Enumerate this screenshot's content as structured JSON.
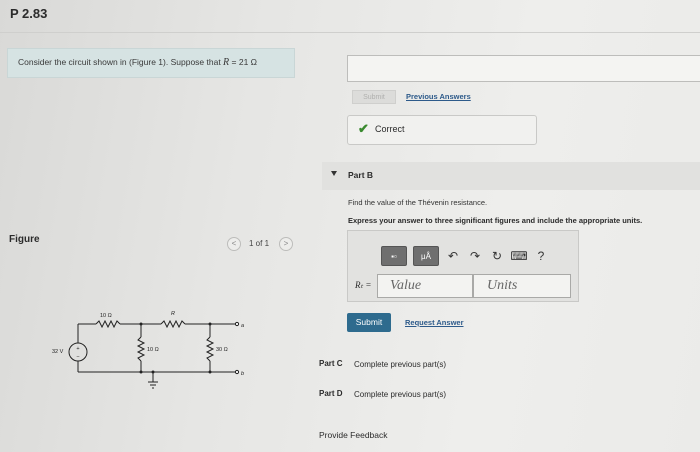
{
  "problem": {
    "title": "P 2.83",
    "statement_prefix": "Consider the circuit shown in (Figure 1). Suppose that ",
    "statement_var": "R",
    "statement_suffix": " = 21 Ω"
  },
  "part_a": {
    "submit_label": "Submit",
    "previous_answers_label": "Previous Answers",
    "status_text": "Correct"
  },
  "part_b": {
    "label": "Part B",
    "prompt": "Find the value of the Thévenin resistance.",
    "instructions": "Express your answer to three significant figures and include the appropriate units.",
    "toolbar": {
      "templates_label": "▪▫",
      "units_label": "μÅ",
      "help_label": "?"
    },
    "var_label": "Rₜ =",
    "value_placeholder": "Value",
    "units_placeholder": "Units",
    "submit_label": "Submit",
    "request_answer_label": "Request Answer"
  },
  "part_c": {
    "label": "Part C",
    "status": "Complete previous part(s)"
  },
  "part_d": {
    "label": "Part D",
    "status": "Complete previous part(s)"
  },
  "feedback_label": "Provide Feedback",
  "figure": {
    "label": "Figure",
    "counter": "1 of 1",
    "prev_symbol": "<",
    "next_symbol": ">",
    "labels": {
      "r_top": "10 Ω",
      "r_var": "R",
      "source": "32 V",
      "r_mid": "10 Ω",
      "r_right": "30 Ω",
      "term_a": "a",
      "term_b": "b",
      "src_plus": "+",
      "src_minus": "−"
    }
  },
  "colors": {
    "accent": "#2e6b8e",
    "link": "#2d5a8a",
    "correct": "#3a8a2f"
  }
}
